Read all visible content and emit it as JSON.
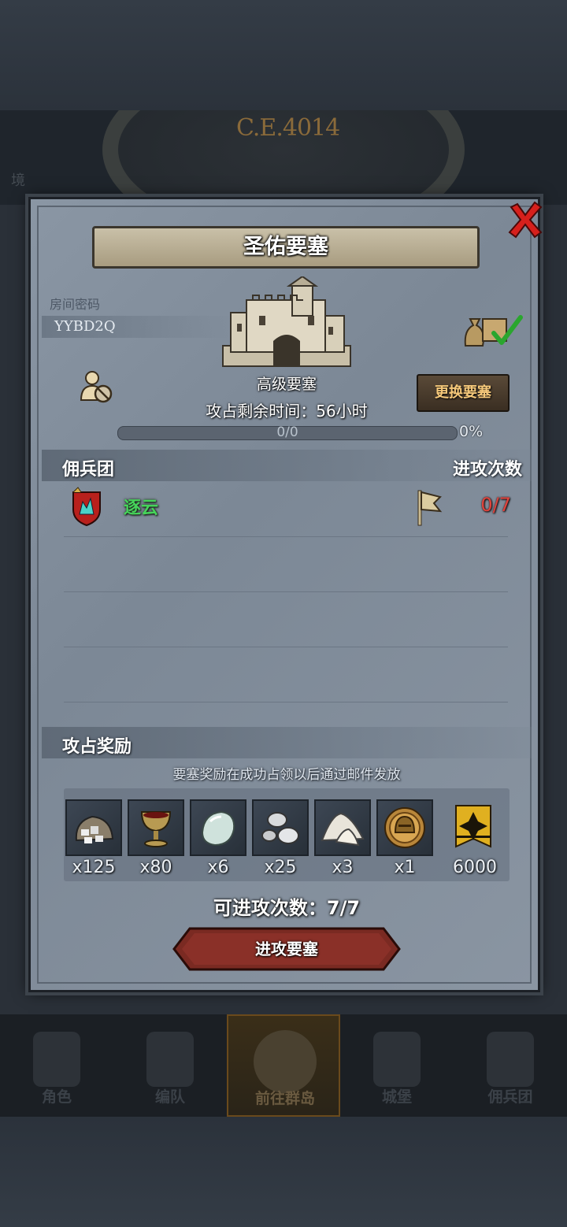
{
  "background": {
    "era_label": "C.E.4014",
    "nav_items": [
      "角色",
      "编队",
      "前往群岛",
      "城堡",
      "佣兵团"
    ],
    "active_nav": "前往群岛"
  },
  "dialog": {
    "title": "圣佑要塞",
    "room_code_label": "房间密码",
    "room_code": "YYBD2Q",
    "fortress_level": "高级要塞",
    "remaining_time": "攻占剩余时间：56小时",
    "change_button": "更换要塞",
    "progress": {
      "text": "0/0",
      "percent_label": "0%",
      "value": 0
    },
    "mercenary_section": {
      "title": "佣兵团",
      "right_label": "进攻次数"
    },
    "guilds": [
      {
        "name": "逐云",
        "attacks": "0/7"
      }
    ],
    "rewards_section": {
      "title": "攻占奖励",
      "note": "要塞奖励在成功占领以后通过邮件发放",
      "items": [
        {
          "icon": "ore-sack-icon",
          "qty": "x125"
        },
        {
          "icon": "goblet-icon",
          "qty": "x80"
        },
        {
          "icon": "gem-stone-icon",
          "qty": "x6"
        },
        {
          "icon": "silver-ore-icon",
          "qty": "x25"
        },
        {
          "icon": "salt-pile-icon",
          "qty": "x3"
        },
        {
          "icon": "knight-helmet-coin-icon",
          "qty": "x1"
        },
        {
          "icon": "guild-banner-icon",
          "qty": "6000"
        }
      ]
    },
    "attacks_left": "可进攻次数：7/7",
    "attack_button": "进攻要塞"
  },
  "colors": {
    "guild_name": "#46d35a",
    "attack_count": "#e0433c",
    "change_button_text": "#f5c87a"
  }
}
